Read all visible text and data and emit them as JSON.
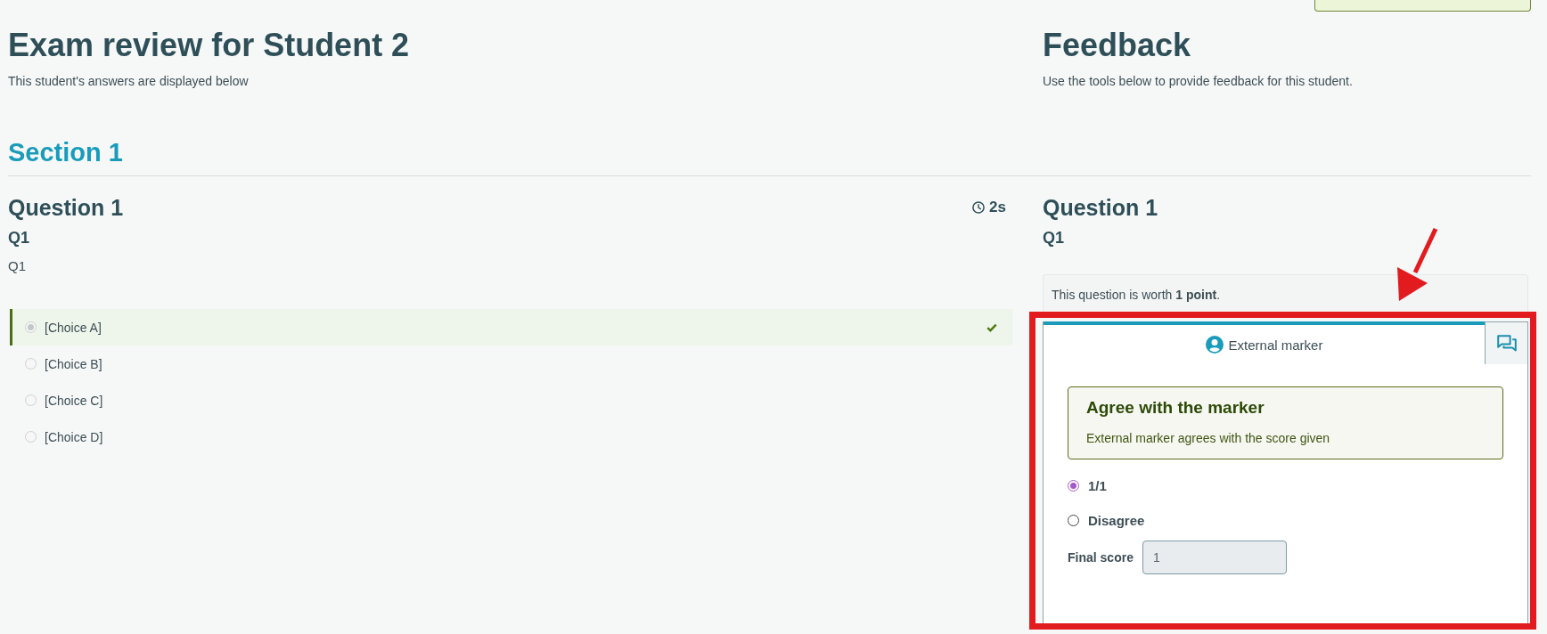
{
  "header": {
    "title": "Exam review for Student 2",
    "subtitle": "This student's answers are displayed below"
  },
  "feedback_header": {
    "title": "Feedback",
    "subtitle": "Use the tools below to provide feedback for this student."
  },
  "section": {
    "title": "Section 1"
  },
  "question": {
    "title": "Question 1",
    "time": "2s",
    "name": "Q1",
    "text": "Q1",
    "choices": [
      {
        "label": "[Choice A]",
        "selected": true,
        "correct": true
      },
      {
        "label": "[Choice B]",
        "selected": false,
        "correct": false
      },
      {
        "label": "[Choice C]",
        "selected": false,
        "correct": false
      },
      {
        "label": "[Choice D]",
        "selected": false,
        "correct": false
      }
    ]
  },
  "feedback": {
    "title": "Question 1",
    "name": "Q1",
    "worth": "This question is worth **1 point**.",
    "tabs": [
      {
        "kind": "marker",
        "label": "External marker",
        "selected": true
      },
      {
        "kind": "comments",
        "selected": false
      }
    ],
    "verdict": {
      "title": "Agree with the marker",
      "text": "External marker agrees with the score given"
    },
    "options": [
      {
        "label": "1/1",
        "selected": true
      },
      {
        "label": "Disagree",
        "selected": false
      }
    ],
    "final_score": {
      "label": "Final score",
      "value": "1"
    }
  }
}
